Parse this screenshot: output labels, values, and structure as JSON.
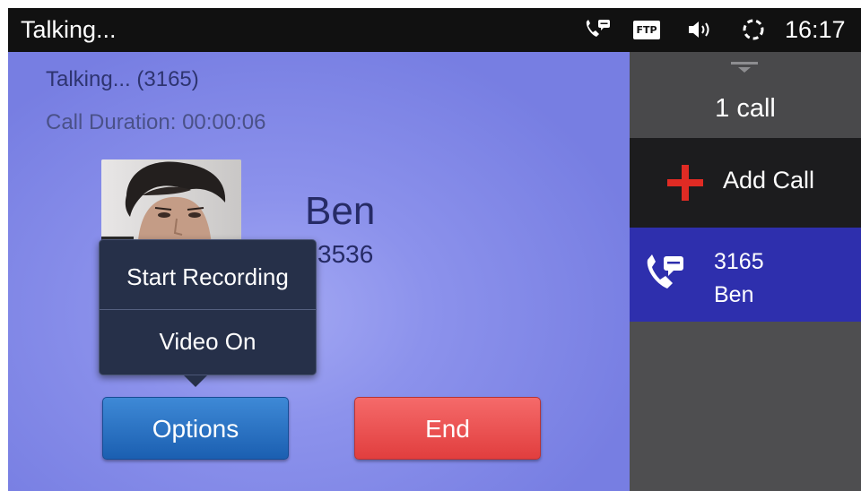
{
  "status_bar": {
    "title": "Talking...",
    "ftp_badge": "FTP",
    "time": "16:17",
    "icons": [
      "phone-chat-icon",
      "ftp-icon",
      "speaker-volume-icon",
      "sync-loading-icon"
    ]
  },
  "call": {
    "status": "Talking... (3165)",
    "duration": "Call Duration: 00:00:06",
    "contact_name": "Ben",
    "contact_number_partial": "3536"
  },
  "options_menu": {
    "items": [
      "Start Recording",
      "Video On"
    ]
  },
  "buttons": {
    "options": "Options",
    "end": "End"
  },
  "side_panel": {
    "call_count": "1 call",
    "add_call": "Add Call",
    "active_call": {
      "number": "3165",
      "name": "Ben"
    }
  },
  "colors": {
    "status_bar_bg": "#111111",
    "call_area_bg": "#7a80e0",
    "options_button": "#2a72c4",
    "end_button": "#eb5252",
    "active_call_bg": "#2e2fad",
    "add_call_plus": "#e02b24"
  }
}
